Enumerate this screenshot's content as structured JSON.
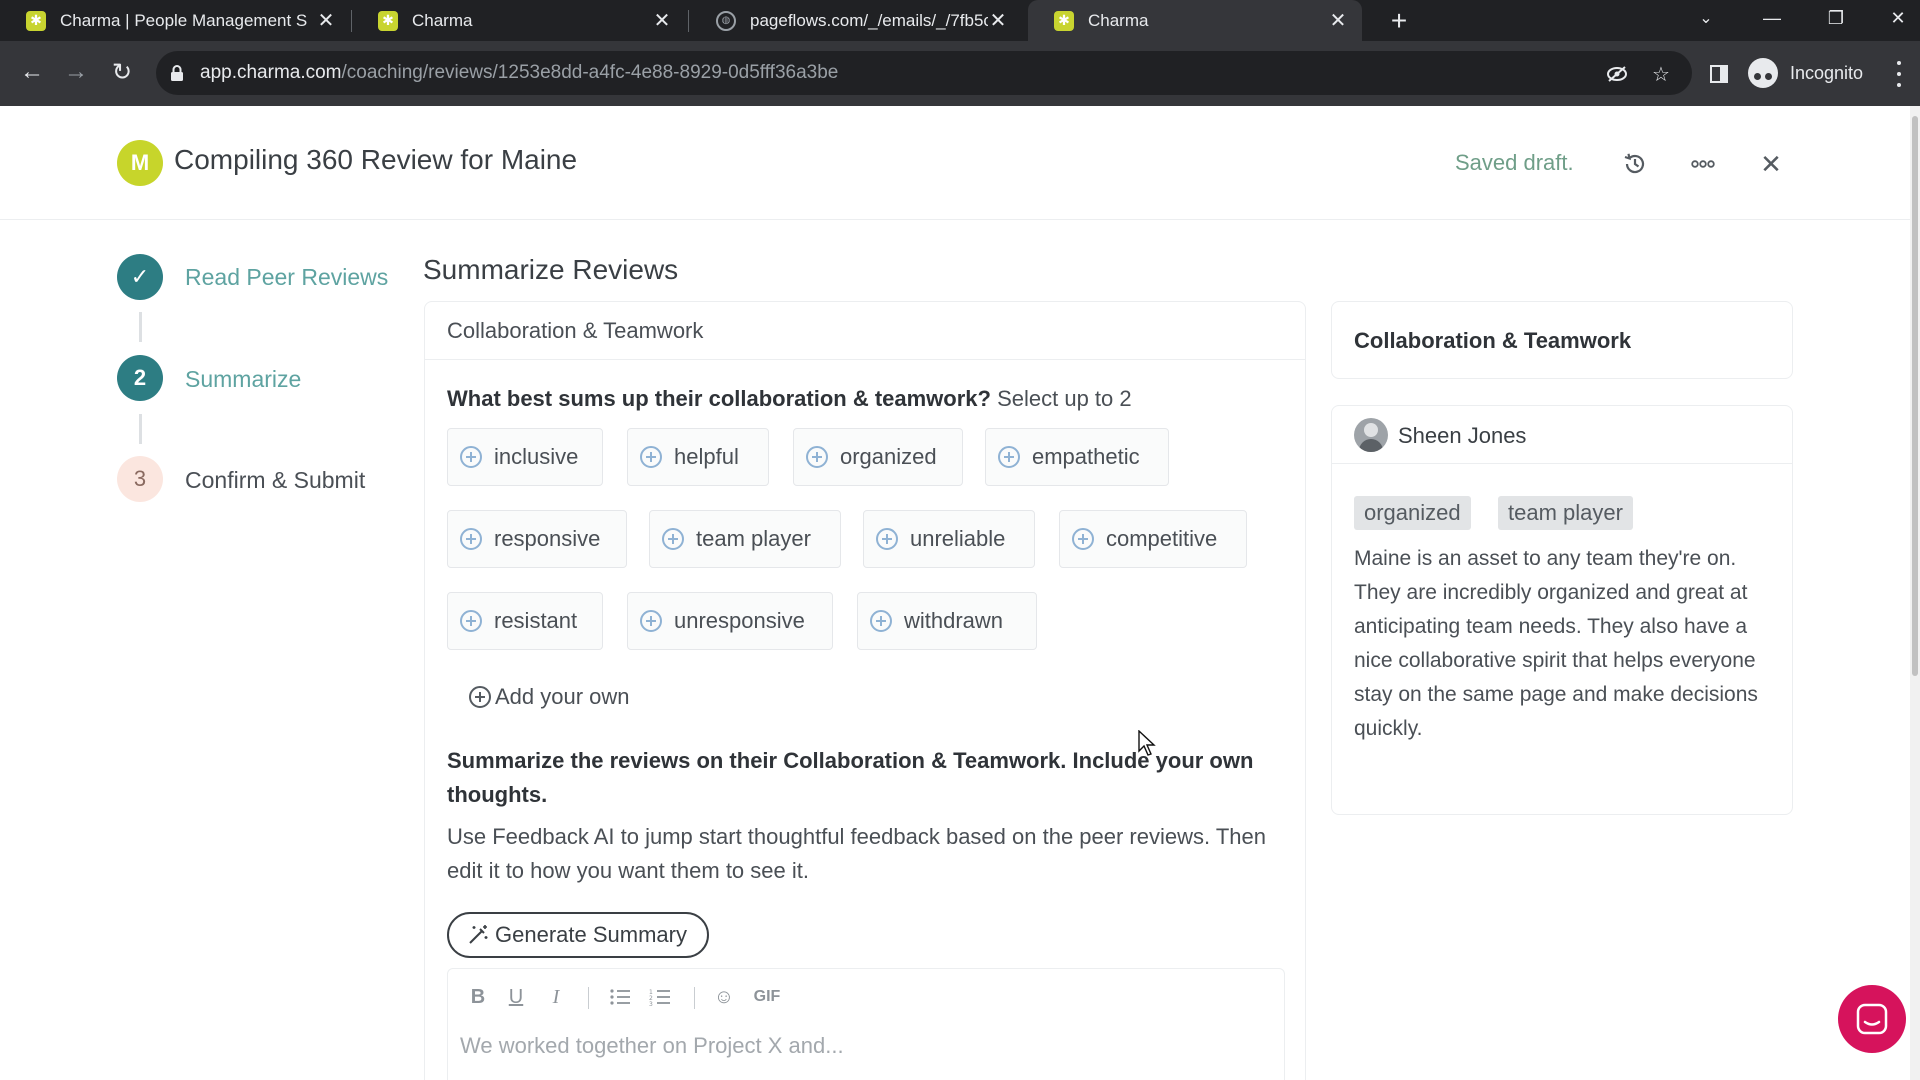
{
  "browser": {
    "tabs": [
      {
        "title": "Charma | People Management S",
        "favicon": "charma-logo-icon",
        "active": false
      },
      {
        "title": "Charma",
        "favicon": "charma-logo-icon",
        "active": false
      },
      {
        "title": "pageflows.com/_/emails/_/7fb5c",
        "favicon": "globe-icon",
        "active": false
      },
      {
        "title": "Charma",
        "favicon": "charma-logo-icon",
        "active": true
      }
    ],
    "url_host": "app.charma.com",
    "url_path": "/coaching/reviews/1253e8dd-a4fc-4e88-8929-0d5fff36a3be",
    "profile_label": "Incognito"
  },
  "header": {
    "avatar_initial": "M",
    "title": "Compiling 360 Review for Maine",
    "saved_status": "Saved draft."
  },
  "steps": [
    {
      "marker": "✓",
      "label": "Read Peer Reviews",
      "state": "done"
    },
    {
      "marker": "2",
      "label": "Summarize",
      "state": "current"
    },
    {
      "marker": "3",
      "label": "Confirm & Submit",
      "state": "todo"
    }
  ],
  "main": {
    "section_title": "Summarize Reviews",
    "card_title": "Collaboration & Teamwork",
    "question": "What best sums up their collaboration & teamwork?",
    "question_hint": "Select up to 2",
    "chips": [
      "inclusive",
      "helpful",
      "organized",
      "empathetic",
      "responsive",
      "team player",
      "unreliable",
      "competitive",
      "resistant",
      "unresponsive",
      "withdrawn"
    ],
    "add_own_label": "Add your own",
    "prompt": "Summarize the reviews on their Collaboration & Teamwork. Include your own thoughts.",
    "help_text": "Use Feedback AI to jump start thoughtful feedback based on the peer reviews. Then edit it to how you want them to see it.",
    "generate_label": "Generate Summary",
    "editor": {
      "gif_label": "GIF",
      "placeholder": "We worked together on Project X and..."
    }
  },
  "right_panel": {
    "title": "Collaboration & Teamwork",
    "reviewer_name": "Sheen Jones",
    "tags": [
      "organized",
      "team player"
    ],
    "review_text": "Maine is an asset to any team they're on. They are incredibly organized and great at anticipating team needs. They also have a nice collaborative spirit that helps everyone stay on the same page and make decisions quickly."
  },
  "colors": {
    "accent_teal": "#2d7d83",
    "brand_lime": "#c7d52b",
    "saved_green": "#6f9e88",
    "chat_pink": "#d6135c"
  }
}
